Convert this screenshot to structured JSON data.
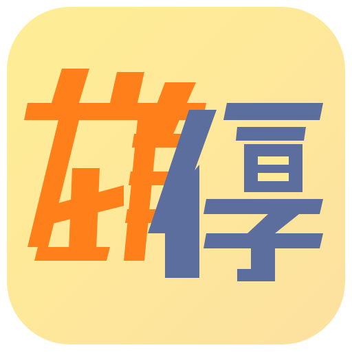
{
  "icon": {
    "logo_text": "雄停",
    "background_gradient": [
      "#FEEE95",
      "#FDE1A0"
    ],
    "glyph_colors": {
      "first_character": "#FF7F1A",
      "second_character": "#5C6E9E"
    }
  }
}
